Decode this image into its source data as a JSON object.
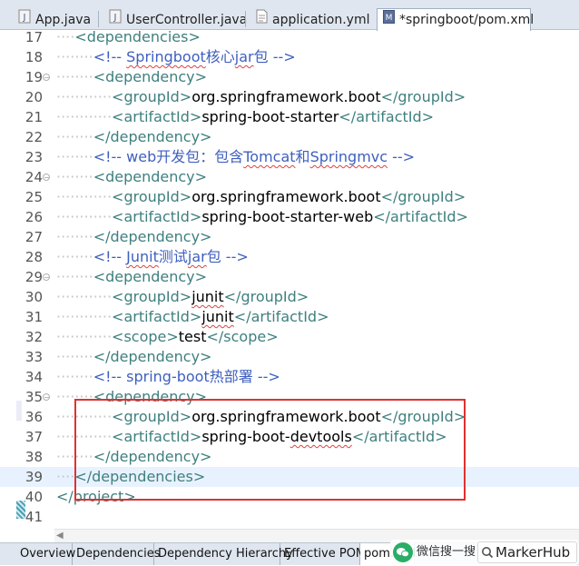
{
  "tabs": [
    {
      "label": "App.java",
      "icon": "java-file-icon"
    },
    {
      "label": "UserController.java",
      "icon": "java-file-icon"
    },
    {
      "label": "application.yml",
      "icon": "text-file-icon"
    },
    {
      "label": "*springboot/pom.xml",
      "icon": "maven-pom-icon",
      "active": true
    }
  ],
  "lines": [
    {
      "n": "17",
      "indent": 1,
      "parts": [
        {
          "c": "tag",
          "t": "<dependencies>"
        }
      ]
    },
    {
      "n": "18",
      "indent": 2,
      "parts": [
        {
          "c": "cm",
          "t": "<!-- "
        },
        {
          "c": "cm sq",
          "t": "Springboot"
        },
        {
          "c": "cm",
          "t": "核心"
        },
        {
          "c": "cm sq",
          "t": "jar"
        },
        {
          "c": "cm",
          "t": "包 -->"
        }
      ]
    },
    {
      "n": "19",
      "indent": 2,
      "fold": true,
      "parts": [
        {
          "c": "tag",
          "t": "<dependency>"
        }
      ]
    },
    {
      "n": "20",
      "indent": 3,
      "parts": [
        {
          "c": "tag",
          "t": "<groupId>"
        },
        {
          "c": "txt",
          "t": "org.springframework.boot"
        },
        {
          "c": "tag",
          "t": "</groupId>"
        }
      ]
    },
    {
      "n": "21",
      "indent": 3,
      "parts": [
        {
          "c": "tag",
          "t": "<artifactId>"
        },
        {
          "c": "txt",
          "t": "spring-boot-starter"
        },
        {
          "c": "tag",
          "t": "</artifactId>"
        }
      ]
    },
    {
      "n": "22",
      "indent": 2,
      "parts": [
        {
          "c": "tag",
          "t": "</dependency>"
        }
      ]
    },
    {
      "n": "23",
      "indent": 2,
      "parts": [
        {
          "c": "cm",
          "t": "<!-- web开发包：包含"
        },
        {
          "c": "cm sq",
          "t": "Tomcat"
        },
        {
          "c": "cm",
          "t": "和"
        },
        {
          "c": "cm sq",
          "t": "Springmvc"
        },
        {
          "c": "cm",
          "t": " -->"
        }
      ]
    },
    {
      "n": "24",
      "indent": 2,
      "fold": true,
      "parts": [
        {
          "c": "tag",
          "t": "<dependency>"
        }
      ]
    },
    {
      "n": "25",
      "indent": 3,
      "parts": [
        {
          "c": "tag",
          "t": "<groupId>"
        },
        {
          "c": "txt",
          "t": "org.springframework.boot"
        },
        {
          "c": "tag",
          "t": "</groupId>"
        }
      ]
    },
    {
      "n": "26",
      "indent": 3,
      "parts": [
        {
          "c": "tag",
          "t": "<artifactId>"
        },
        {
          "c": "txt",
          "t": "spring-boot-starter-web"
        },
        {
          "c": "tag",
          "t": "</artifactId>"
        }
      ]
    },
    {
      "n": "27",
      "indent": 2,
      "parts": [
        {
          "c": "tag",
          "t": "</dependency>"
        }
      ]
    },
    {
      "n": "28",
      "indent": 2,
      "parts": [
        {
          "c": "cm",
          "t": "<!-- "
        },
        {
          "c": "cm sq",
          "t": "Junit"
        },
        {
          "c": "cm",
          "t": "测试"
        },
        {
          "c": "cm sq",
          "t": "jar"
        },
        {
          "c": "cm",
          "t": "包 -->"
        }
      ]
    },
    {
      "n": "29",
      "indent": 2,
      "fold": true,
      "parts": [
        {
          "c": "tag",
          "t": "<dependency>"
        }
      ]
    },
    {
      "n": "30",
      "indent": 3,
      "parts": [
        {
          "c": "tag",
          "t": "<groupId>"
        },
        {
          "c": "txt sq",
          "t": "junit"
        },
        {
          "c": "tag",
          "t": "</groupId>"
        }
      ]
    },
    {
      "n": "31",
      "indent": 3,
      "parts": [
        {
          "c": "tag",
          "t": "<artifactId>"
        },
        {
          "c": "txt sq",
          "t": "junit"
        },
        {
          "c": "tag",
          "t": "</artifactId>"
        }
      ]
    },
    {
      "n": "32",
      "indent": 3,
      "parts": [
        {
          "c": "tag",
          "t": "<scope>"
        },
        {
          "c": "txt",
          "t": "test"
        },
        {
          "c": "tag",
          "t": "</scope>"
        }
      ]
    },
    {
      "n": "33",
      "indent": 2,
      "parts": [
        {
          "c": "tag",
          "t": "</dependency>"
        }
      ]
    },
    {
      "n": "34",
      "indent": 2,
      "parts": [
        {
          "c": "cm",
          "t": "<!-- spring-boot热部署 -->"
        }
      ]
    },
    {
      "n": "35",
      "indent": 2,
      "fold": true,
      "parts": [
        {
          "c": "tag",
          "t": "<dependency>"
        }
      ]
    },
    {
      "n": "36",
      "indent": 3,
      "parts": [
        {
          "c": "tag",
          "t": "<groupId>"
        },
        {
          "c": "txt",
          "t": "org.springframework.boot"
        },
        {
          "c": "tag",
          "t": "</groupId>"
        }
      ]
    },
    {
      "n": "37",
      "indent": 3,
      "parts": [
        {
          "c": "tag",
          "t": "<artifactId>"
        },
        {
          "c": "txt",
          "t": "spring-boot-"
        },
        {
          "c": "txt sq",
          "t": "devtools"
        },
        {
          "c": "tag",
          "t": "</artifactId>"
        }
      ]
    },
    {
      "n": "38",
      "indent": 2,
      "parts": [
        {
          "c": "tag",
          "t": "</dependency>"
        }
      ]
    },
    {
      "n": "39",
      "indent": 1,
      "current": true,
      "parts": [
        {
          "c": "tag",
          "t": "</dependencies>"
        }
      ]
    },
    {
      "n": "40",
      "indent": 0,
      "parts": [
        {
          "c": "tag",
          "t": "</project>"
        }
      ]
    },
    {
      "n": "41",
      "indent": 0,
      "parts": []
    }
  ],
  "bottom_tabs": [
    {
      "label": "Overview"
    },
    {
      "label": "Dependencies"
    },
    {
      "label": "Dependency Hierarchy"
    },
    {
      "label": "Effective POM"
    },
    {
      "label": "pom.xml",
      "active": true
    }
  ],
  "watermark": {
    "text": "微信搜一搜",
    "brand": "MarkerHub"
  },
  "colors": {
    "tag": "#3f7f7f",
    "comment": "#3f5fbf",
    "highlight_box": "#e03131"
  }
}
